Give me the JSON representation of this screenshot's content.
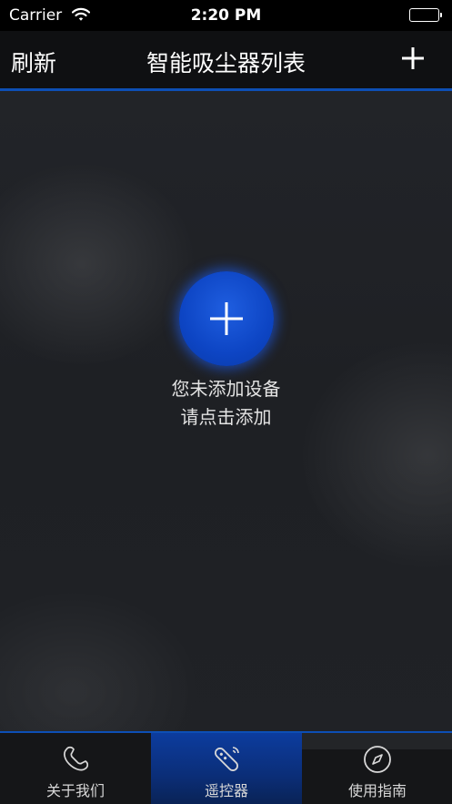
{
  "status_bar": {
    "carrier": "Carrier",
    "time": "2:20 PM"
  },
  "nav": {
    "left_button": "刷新",
    "title": "智能吸尘器列表",
    "right_icon": "plus-icon"
  },
  "main": {
    "add_icon": "plus-icon",
    "empty_line1": "您未添加设备",
    "empty_line2": "请点击添加"
  },
  "tabs": [
    {
      "label": "遥控器",
      "icon": "remote-icon",
      "active": true
    },
    {
      "label": "使用指南",
      "icon": "compass-icon",
      "active": false
    },
    {
      "label": "关于我们",
      "icon": "phone-icon",
      "active": false
    }
  ],
  "colors": {
    "accent": "#0d4fb5",
    "button_blue": "#0d45c4",
    "background": "#202226"
  }
}
